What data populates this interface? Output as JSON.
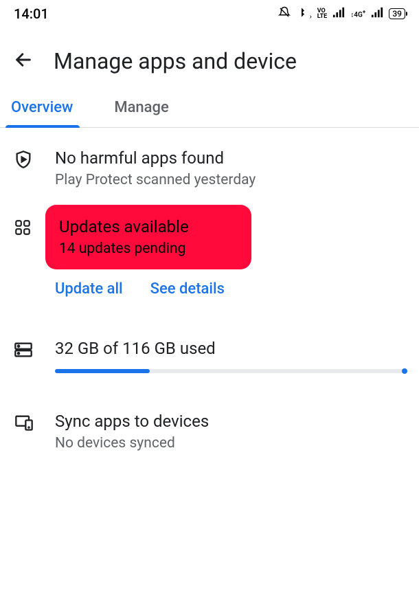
{
  "statusBar": {
    "time": "14:01",
    "battery": "39",
    "volte": "VO\nLTE"
  },
  "header": {
    "title": "Manage apps and device"
  },
  "tabs": {
    "overview": "Overview",
    "manage": "Manage"
  },
  "playProtect": {
    "title": "No harmful apps found",
    "subtitle": "Play Protect scanned yesterday"
  },
  "updates": {
    "title": "Updates available",
    "subtitle": "14 updates pending",
    "updateAll": "Update all",
    "seeDetails": "See details"
  },
  "storage": {
    "title": "32 GB of 116 GB used"
  },
  "sync": {
    "title": "Sync apps to devices",
    "subtitle": "No devices synced"
  }
}
